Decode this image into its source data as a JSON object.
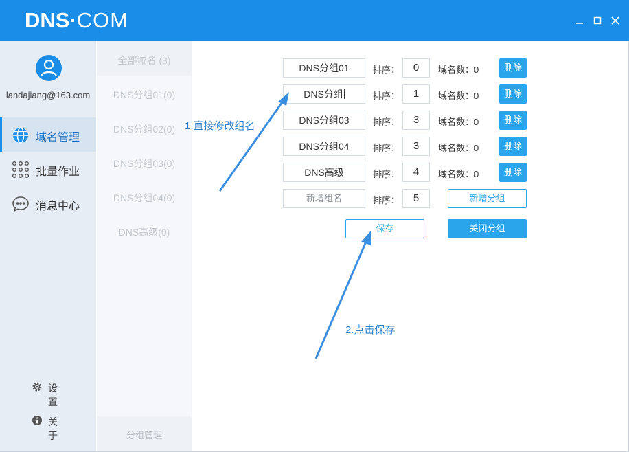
{
  "app": {
    "logo_bold": "DNS",
    "logo_dot": "·",
    "logo_light": "COM",
    "window_controls": {
      "minimize": "minimize-icon",
      "maximize": "maximize-icon",
      "close": "close-icon"
    }
  },
  "user": {
    "email": "landajiang@163.com",
    "avatar_icon": "user-icon"
  },
  "nav": [
    {
      "label": "域名管理",
      "icon": "globe-icon",
      "active": true
    },
    {
      "label": "批量作业",
      "icon": "grid-dots-icon",
      "active": false
    },
    {
      "label": "消息中心",
      "icon": "chat-bubble-icon",
      "active": false
    }
  ],
  "footer_nav": [
    {
      "label": "设置",
      "icon": "gear-icon"
    },
    {
      "label": "关于",
      "icon": "info-icon"
    }
  ],
  "groups": {
    "all": "全部域名 (8)",
    "items": [
      "DNS分组01(0)",
      "DNS分组02(0)",
      "DNS分组03(0)",
      "DNS分组04(0)",
      "DNS高级(0)"
    ],
    "manage": "分组管理"
  },
  "editor": {
    "sort_label": "排序：",
    "count_label": "域名数：",
    "delete_label": "删除",
    "rows": [
      {
        "name": "DNS分组01",
        "sort": "0",
        "count": "0"
      },
      {
        "name": "DNS分组",
        "sort": "1",
        "count": "0"
      },
      {
        "name": "DNS分组03",
        "sort": "3",
        "count": "0"
      },
      {
        "name": "DNS分组04",
        "sort": "3",
        "count": "0"
      },
      {
        "name": "DNS高级",
        "sort": "4",
        "count": "0"
      }
    ],
    "new_row": {
      "placeholder": "新增组名",
      "sort": "5",
      "add_button": "新增分组"
    },
    "save_button": "保存",
    "close_button": "关闭分组"
  },
  "annotations": {
    "step1": "1.直接修改组名",
    "step2": "2.点击保存",
    "color": "#2f7fc8"
  },
  "colors": {
    "accent": "#1a8de9",
    "button": "#2aa5ec"
  }
}
